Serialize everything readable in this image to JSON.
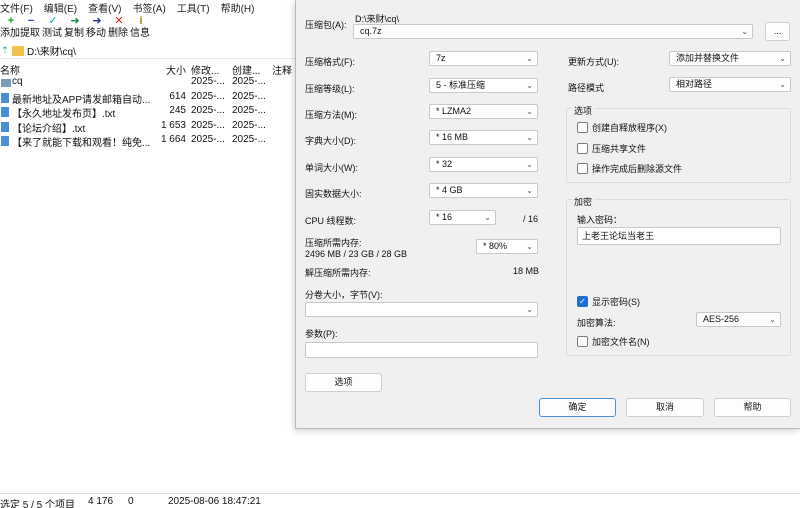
{
  "fm": {
    "menu": [
      "文件(F)",
      "编辑(E)",
      "查看(V)",
      "书签(A)",
      "工具(T)",
      "帮助(H)"
    ],
    "toolbar": [
      {
        "icon": "+",
        "label": "添加",
        "color": "#1a9b2b"
      },
      {
        "icon": "−",
        "label": "提取",
        "color": "#2142b8"
      },
      {
        "icon": "✓",
        "label": "测试",
        "color": "#1aa6a6"
      },
      {
        "icon": "➜",
        "label": "复制",
        "color": "#1a8a4a"
      },
      {
        "icon": "➜",
        "label": "移动",
        "color": "#1f2fa0"
      },
      {
        "icon": "✕",
        "label": "删除",
        "color": "#d02020"
      },
      {
        "icon": "i",
        "label": "信息",
        "color": "#9a8a20"
      }
    ],
    "address": "D:\\来财\\cq\\",
    "columns": {
      "name": "名称",
      "size": "大小",
      "modified": "修改...",
      "created": "创建...",
      "comment": "注释"
    },
    "rows": [
      {
        "name": "cq",
        "size": "",
        "modified": "2025-...",
        "created": "2025-...",
        "dir": true
      },
      {
        "name": "最新地址及APP请发邮箱自动...",
        "size": "614",
        "modified": "2025-...",
        "created": "2025-...",
        "dir": false
      },
      {
        "name": "【永久地址发布页】.txt",
        "size": "245",
        "modified": "2025-...",
        "created": "2025-...",
        "dir": false
      },
      {
        "name": "【论坛介绍】.txt",
        "size": "1 653",
        "modified": "2025-...",
        "created": "2025-...",
        "dir": false
      },
      {
        "name": "【来了就能下载和观看！纯免...",
        "size": "1 664",
        "modified": "2025-...",
        "created": "2025-...",
        "dir": false
      }
    ],
    "status": {
      "selected": "选定 5 / 5 个项目",
      "size": "4 176",
      "zero": "0",
      "date": "2025-08-06 18:47:21"
    }
  },
  "dialog": {
    "archive_label": "压缩包(A):",
    "archive_path": "D:\\来财\\cq\\",
    "archive_name": "cq.7z",
    "browse_label": "...",
    "format_label": "压缩格式(F):",
    "format_value": "7z",
    "level_label": "压缩等级(L):",
    "level_value": "5 - 标准压缩",
    "method_label": "压缩方法(M):",
    "method_value": "*  LZMA2",
    "dict_label": "字典大小(D):",
    "dict_value": "*  16 MB",
    "word_label": "单词大小(W):",
    "word_value": "*  32",
    "solid_label": "固实数据大小:",
    "solid_value": "*  4 GB",
    "threads_label": "CPU 线程数:",
    "threads_value": "*  16",
    "threads_total": "/ 16",
    "mem_label": "压缩所需内存:",
    "mem_value": "2496 MB / 23 GB / 28 GB",
    "mem_pct": "* 80%",
    "demem_label": "解压缩所需内存:",
    "demem_value": "18 MB",
    "split_label": "分卷大小，字节(V):",
    "split_value": "",
    "params_label": "参数(P):",
    "params_value": "",
    "options_btn": "选项",
    "update_label": "更新方式(U):",
    "update_value": "添加并替换文件",
    "pathmode_label": "路径模式",
    "pathmode_value": "相对路径",
    "options_group": "选项",
    "opt_sfx": "创建自释放程序(X)",
    "opt_shared": "压缩共享文件",
    "opt_delete": "操作完成后删除源文件",
    "enc_group": "加密",
    "pwd_label": "输入密码：",
    "pwd_value": "上老王论坛当老王",
    "show_pwd": "显示密码(S)",
    "enc_method_label": "加密算法:",
    "enc_method_value": "AES-256",
    "enc_names": "加密文件名(N)",
    "ok": "确定",
    "cancel": "取消",
    "help": "帮助"
  }
}
